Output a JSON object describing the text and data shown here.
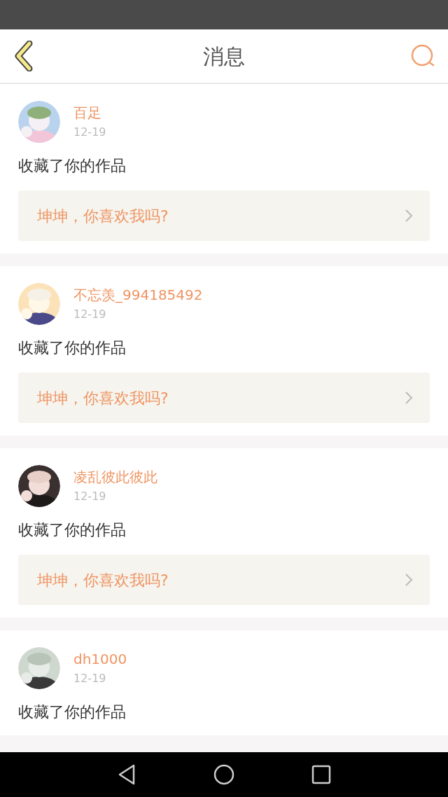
{
  "header": {
    "title": "消息"
  },
  "messages": [
    {
      "user": "百足",
      "date": "12-19",
      "action": "收藏了你的作品",
      "quote": "坤坤，你喜欢我吗?"
    },
    {
      "user": "不忘羡_994185492",
      "date": "12-19",
      "action": "收藏了你的作品",
      "quote": "坤坤，你喜欢我吗?"
    },
    {
      "user": "凌乱彼此彼此",
      "date": "12-19",
      "action": "收藏了你的作品",
      "quote": "坤坤，你喜欢我吗?"
    },
    {
      "user": "dh1000",
      "date": "12-19",
      "action": "收藏了你的作品"
    }
  ]
}
